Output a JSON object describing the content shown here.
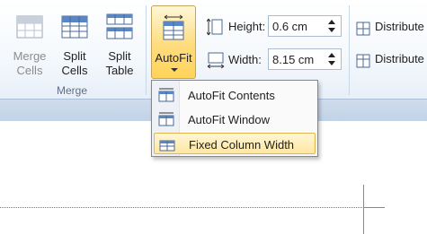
{
  "merge_group": {
    "label": "Merge",
    "merge_cells": "Merge\nCells",
    "split_cells": "Split\nCells",
    "split_table": "Split\nTable"
  },
  "autofit": {
    "label": "AutoFit"
  },
  "cell_size": {
    "height_label": "Height:",
    "height_value": "0.6 cm",
    "width_label": "Width:",
    "width_value": "8.15 cm"
  },
  "distribute": {
    "rows_label": "Distribute",
    "cols_label": "Distribute"
  },
  "menu": {
    "items": [
      {
        "label": "AutoFit Contents"
      },
      {
        "label": "AutoFit Window"
      },
      {
        "label": "Fixed Column Width"
      }
    ]
  },
  "colors": {
    "highlight": "#ffe7a0",
    "ribbon_bottom": "#c2d3e8"
  }
}
